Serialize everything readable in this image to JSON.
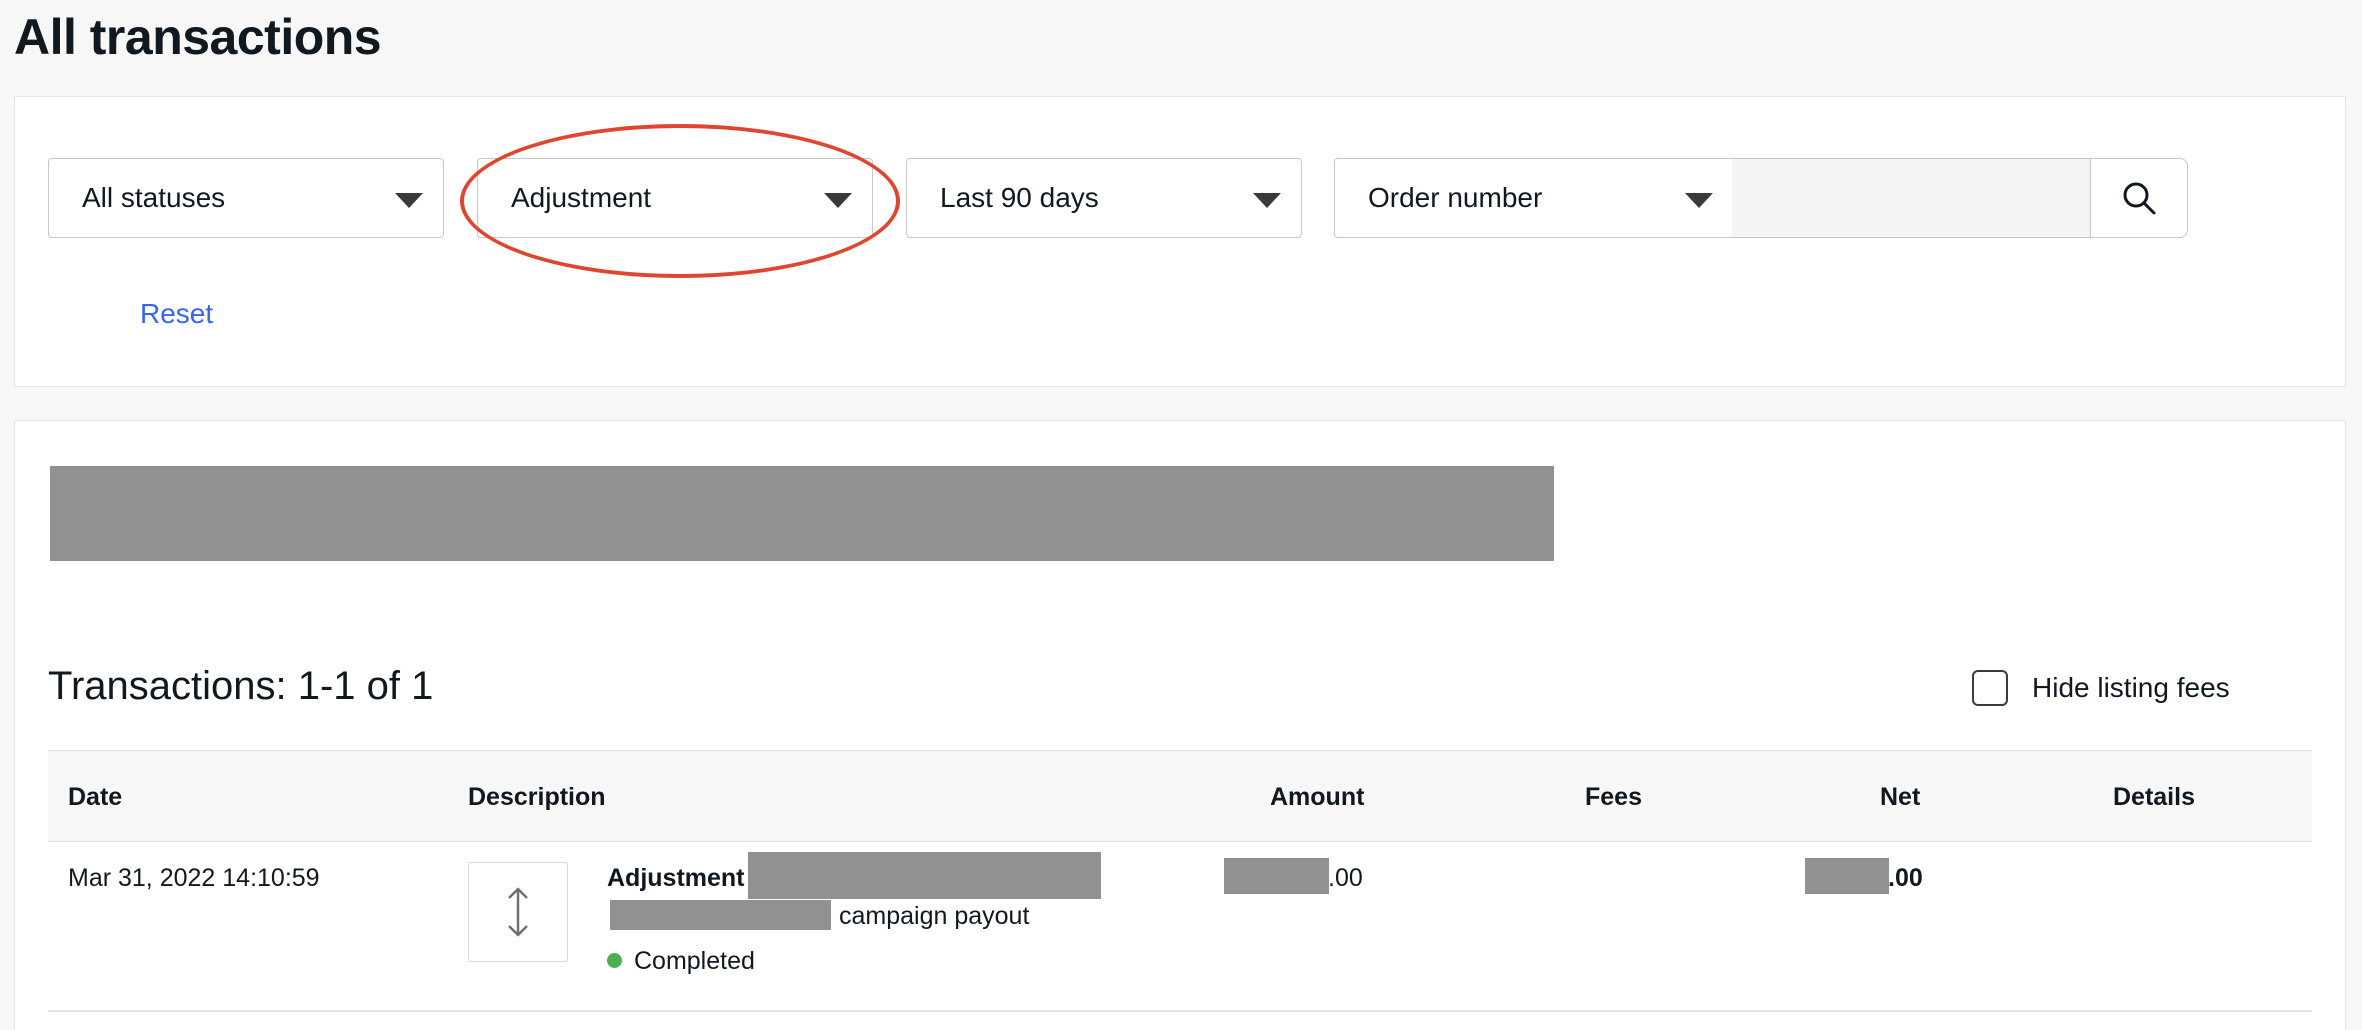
{
  "page": {
    "title": "All transactions"
  },
  "filters": {
    "status": "All statuses",
    "type": "Adjustment",
    "date_range": "Last 90 days",
    "search_type": "Order number",
    "search_value": "",
    "reset_label": "Reset"
  },
  "results": {
    "count_label": "Transactions: 1-1 of 1",
    "hide_fees_label": "Hide listing fees",
    "hide_fees_checked": false,
    "columns": {
      "date": "Date",
      "description": "Description",
      "amount": "Amount",
      "fees": "Fees",
      "net": "Net",
      "details": "Details"
    },
    "rows": [
      {
        "date": "Mar 31, 2022 14:10:59",
        "type": "Adjustment",
        "description_suffix": "campaign payout",
        "status": "Completed",
        "amount_suffix": ".00",
        "net_suffix": ".00"
      }
    ]
  },
  "colors": {
    "link": "#3665f3",
    "annotation": "#e0452f",
    "status_completed": "#4caf50",
    "redaction": "#919191"
  },
  "icons": {
    "search": "search-icon",
    "caret": "caret-down-icon",
    "transaction": "up-down-arrows-icon"
  }
}
